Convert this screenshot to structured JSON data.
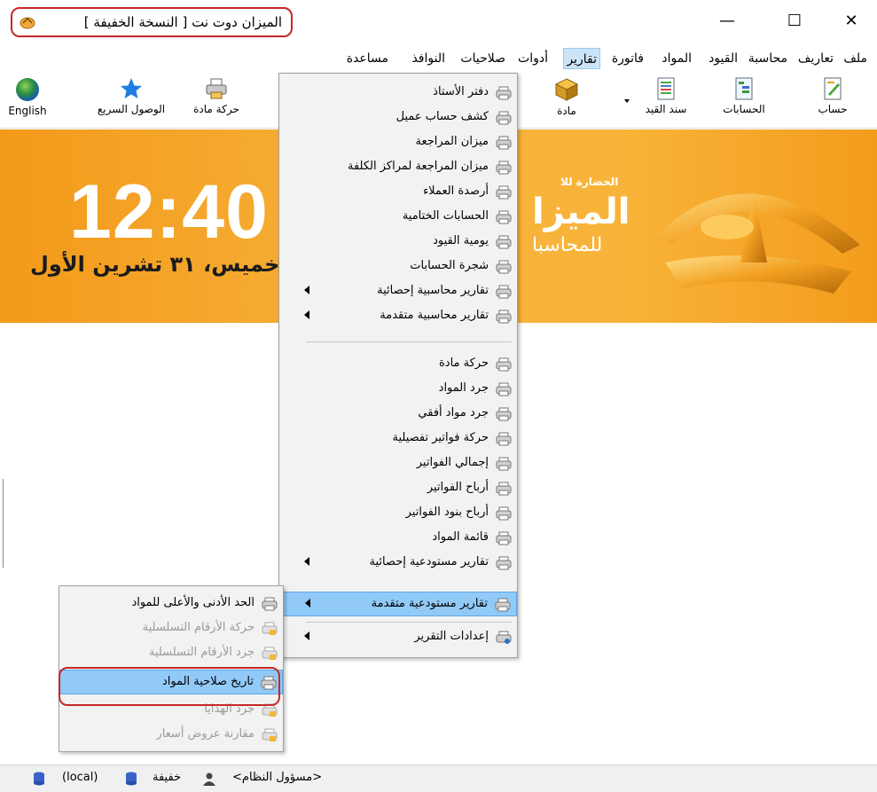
{
  "window": {
    "title": "الميزان دوت نت [ النسخة الخفيفة ]",
    "controls": {
      "close": "✕",
      "maximize": "☐",
      "minimize": "—"
    }
  },
  "menubar": {
    "items": [
      "ملف",
      "تعاريف",
      "محاسبة",
      "القيود",
      "المواد",
      "فاتورة",
      "تقارير",
      "أدوات",
      "صلاحيات",
      "النوافذ",
      "مساعدة"
    ],
    "active": "تقارير"
  },
  "toolbar": {
    "account": "حساب",
    "accounts": "الحسابات",
    "entry_voucher": "سند القيد",
    "material": "مادة",
    "material_movement": "حركة مادة",
    "quick_access": "الوصول السريع",
    "english": "English"
  },
  "banner": {
    "clock": "12:40",
    "date": "خميس، ٣١ تشرين الأول",
    "brand_small": "الحضارة للا",
    "brand_big": "الميزا",
    "brand_sub": "للمحاسبا"
  },
  "reports_menu": {
    "items": [
      {
        "label": "دفتر الأستاذ",
        "submenu": false
      },
      {
        "label": "كشف حساب عميل",
        "submenu": false
      },
      {
        "label": "ميزان المراجعة",
        "submenu": false
      },
      {
        "label": "ميزان المراجعة لمراكز الكلفة",
        "submenu": false
      },
      {
        "label": "أرصدة العملاء",
        "submenu": false
      },
      {
        "label": "الحسابات الختامية",
        "submenu": false
      },
      {
        "label": "يومية القيود",
        "submenu": false
      },
      {
        "label": "شجرة الحسابات",
        "submenu": false
      },
      {
        "label": "تقارير محاسبية إحصائية",
        "submenu": true
      },
      {
        "label": "تقارير محاسبية متقدمة",
        "submenu": true
      },
      {
        "label": "حركة مادة",
        "submenu": false
      },
      {
        "label": "جرد المواد",
        "submenu": false
      },
      {
        "label": "جرد مواد أفقي",
        "submenu": false
      },
      {
        "label": "حركة فواتير تفصيلية",
        "submenu": false
      },
      {
        "label": "إجمالي الفواتير",
        "submenu": false
      },
      {
        "label": "أرباح الفواتير",
        "submenu": false
      },
      {
        "label": "أرباح بنود الفواتير",
        "submenu": false
      },
      {
        "label": "قائمة المواد",
        "submenu": false
      },
      {
        "label": "تقارير مستودعية إحصائية",
        "submenu": true
      },
      {
        "label": "تقارير مستودعية متقدمة",
        "submenu": true
      },
      {
        "label": "إعدادات التقرير",
        "submenu": true
      }
    ]
  },
  "advanced_inventory_submenu": {
    "items": [
      {
        "label": "الحد الأدنى والأعلى للمواد",
        "enabled": true
      },
      {
        "label": "حركة الأرقام التسلسلية",
        "enabled": false
      },
      {
        "label": "جرد الأرقام التسلسلية",
        "enabled": false
      },
      {
        "label": "تاريخ صلاحية المواد",
        "enabled": true,
        "selected": true
      },
      {
        "label": "جرد الهدايا",
        "enabled": false
      },
      {
        "label": "مقارنة عروض أسعار",
        "enabled": false
      }
    ]
  },
  "statusbar": {
    "user": "<مسؤول النظام>",
    "edition": "خفيفة",
    "server": "(local)"
  }
}
